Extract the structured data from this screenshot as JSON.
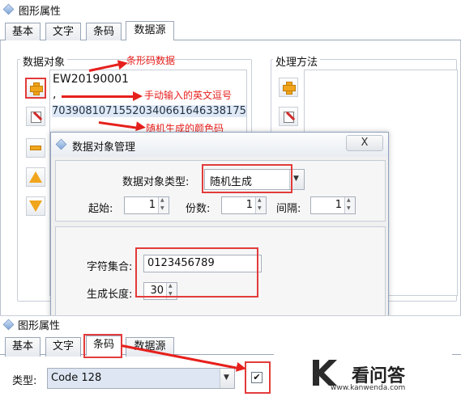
{
  "top_window": {
    "title": "图形属性",
    "tabs": [
      "基本",
      "文字",
      "条码",
      "数据源"
    ],
    "active_tab": "数据源",
    "data_object_group": "数据对象",
    "process_group": "处理方法",
    "data_items": [
      "EW20190001",
      ",",
      "70390810715520340661646338175"
    ]
  },
  "annotations": {
    "barcode_data": "条形码数据",
    "manual_comma": "手动输入的英文逗号",
    "random_color_code": "随机生成的颜色码"
  },
  "dialog": {
    "title": "数据对象管理",
    "close_label": "X",
    "type_label": "数据对象类型:",
    "type_value": "随机生成",
    "start_label": "起始:",
    "start_value": "1",
    "copies_label": "份数:",
    "copies_value": "1",
    "interval_label": "间隔:",
    "interval_value": "1",
    "charset_label": "字符集合:",
    "charset_value": "0123456789",
    "length_label": "生成长度:",
    "length_value": "30"
  },
  "bottom_window": {
    "title": "图形属性",
    "tabs": [
      "基本",
      "文字",
      "条码",
      "数据源"
    ],
    "active_tab": "条码",
    "type_label": "类型:",
    "type_value": "Code 128",
    "checkbox_checked": true
  },
  "watermark": {
    "brand": "看问答",
    "url": "www.kanwenda.com"
  },
  "colors": {
    "annotation_red": "#e6201c",
    "icon_orange": "#f0a51c"
  }
}
